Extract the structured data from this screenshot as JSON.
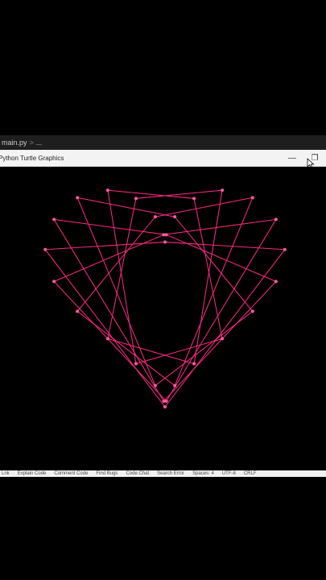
{
  "editor": {
    "breadcrumb_file": "main.py",
    "breadcrumb_separator": ">",
    "breadcrumb_more": "..."
  },
  "window": {
    "title": "Python Turtle Graphics",
    "minimize_glyph": "—",
    "restore_glyph": "❐"
  },
  "canvas": {
    "background": "#000000",
    "line_color": "#ff2a85",
    "dot_color": "#ff5aa0",
    "shape_icon": "heart-string-art"
  },
  "status_bar": {
    "items": [
      "Lnk",
      "Explain Code",
      "Comment Code",
      "Find Bugs",
      "Code Chat",
      "Search Error",
      "Spaces: 4",
      "UTF-8",
      "CRLF"
    ]
  }
}
